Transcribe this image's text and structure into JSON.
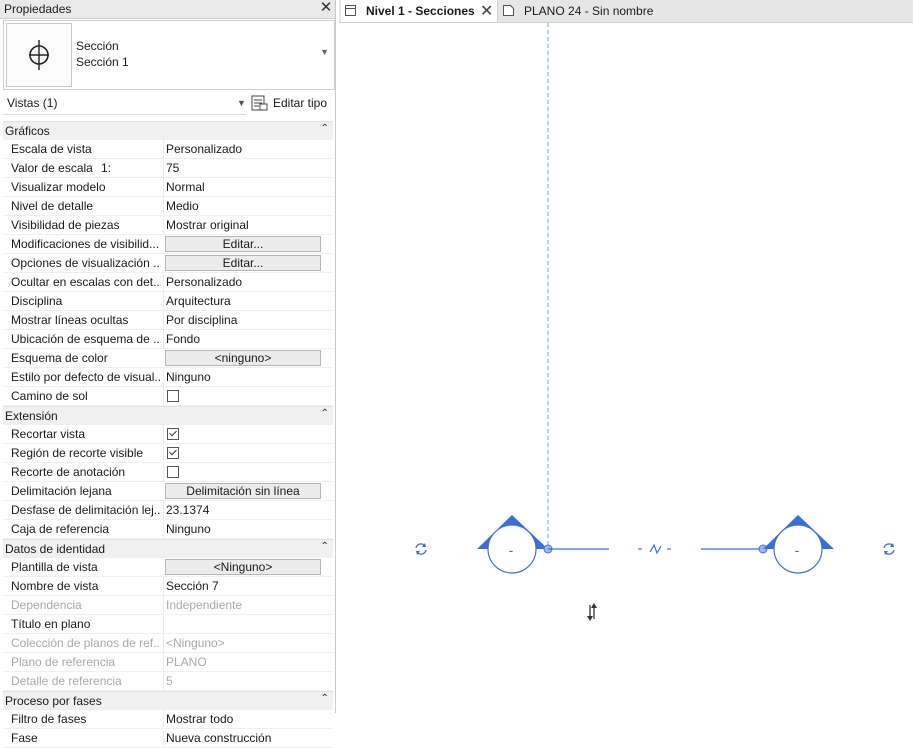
{
  "panel": {
    "title": "Propiedades",
    "type_line1": "Sección",
    "type_line2": "Sección 1",
    "views_label": "Vistas (1)",
    "edit_type_label": "Editar tipo"
  },
  "groups": {
    "graficos": {
      "label": "Gráficos",
      "rows": {
        "escala_vista": {
          "k": "Escala de vista",
          "v": "Personalizado"
        },
        "valor_escala": {
          "k": "Valor de escala",
          "kx": "1:",
          "v": "75"
        },
        "visualizar_modelo": {
          "k": "Visualizar modelo",
          "v": "Normal"
        },
        "nivel_detalle": {
          "k": "Nivel de detalle",
          "v": "Medio"
        },
        "visibilidad_piezas": {
          "k": "Visibilidad de piezas",
          "v": "Mostrar original"
        },
        "modificaciones": {
          "k": "Modificaciones de visibilid...",
          "btn": "Editar..."
        },
        "opciones": {
          "k": "Opciones de visualización ...",
          "btn": "Editar..."
        },
        "ocultar": {
          "k": "Ocultar en escalas con det...",
          "v": "Personalizado"
        },
        "disciplina": {
          "k": "Disciplina",
          "v": "Arquitectura"
        },
        "lineas_ocultas": {
          "k": "Mostrar líneas ocultas",
          "v": "Por disciplina"
        },
        "ubicacion": {
          "k": "Ubicación de esquema de ...",
          "v": "Fondo"
        },
        "esquema_color": {
          "k": "Esquema de color",
          "btn": "<ninguno>"
        },
        "estilo_defecto": {
          "k": "Estilo por defecto de visual...",
          "v": "Ninguno"
        },
        "camino_sol": {
          "k": "Camino de sol",
          "checked": false
        }
      }
    },
    "extension": {
      "label": "Extensión",
      "rows": {
        "recortar_vista": {
          "k": "Recortar vista",
          "checked": true
        },
        "region_recorte": {
          "k": "Región de recorte visible",
          "checked": true
        },
        "recorte_anotacion": {
          "k": "Recorte de anotación",
          "checked": false
        },
        "delimitacion": {
          "k": "Delimitación lejana",
          "btn": "Delimitación sin línea"
        },
        "desfase": {
          "k": "Desfase de delimitación lej...",
          "v": "23.1374"
        },
        "caja_referencia": {
          "k": "Caja de referencia",
          "v": "Ninguno"
        }
      }
    },
    "identidad": {
      "label": "Datos de identidad",
      "rows": {
        "plantilla": {
          "k": "Plantilla de vista",
          "btn": "<Ninguno>"
        },
        "nombre_vista": {
          "k": "Nombre de vista",
          "v": "Sección 7"
        },
        "dependencia": {
          "k": "Dependencia",
          "v": "Independiente"
        },
        "titulo_plano": {
          "k": "Título en plano",
          "v": ""
        },
        "coleccion": {
          "k": "Colección de planos de ref...",
          "v": "<Ninguno>"
        },
        "plano_ref": {
          "k": "Plano de referencia",
          "v": "PLANO"
        },
        "detalle_ref": {
          "k": "Detalle de referencia",
          "v": "5"
        }
      }
    },
    "fases": {
      "label": "Proceso por fases",
      "rows": {
        "filtro": {
          "k": "Filtro de fases",
          "v": "Mostrar todo"
        },
        "fase": {
          "k": "Fase",
          "v": "Nueva construcción"
        }
      }
    }
  },
  "tabs": {
    "tab1": "Nivel 1 - Secciones",
    "tab2": "PLANO 24 - Sin nombre"
  },
  "canvas": {
    "section_head_left_label": "-",
    "section_head_right_label": "-",
    "accent_color": "#3c6fd6",
    "crop_line_color": "#6fc1e6"
  }
}
